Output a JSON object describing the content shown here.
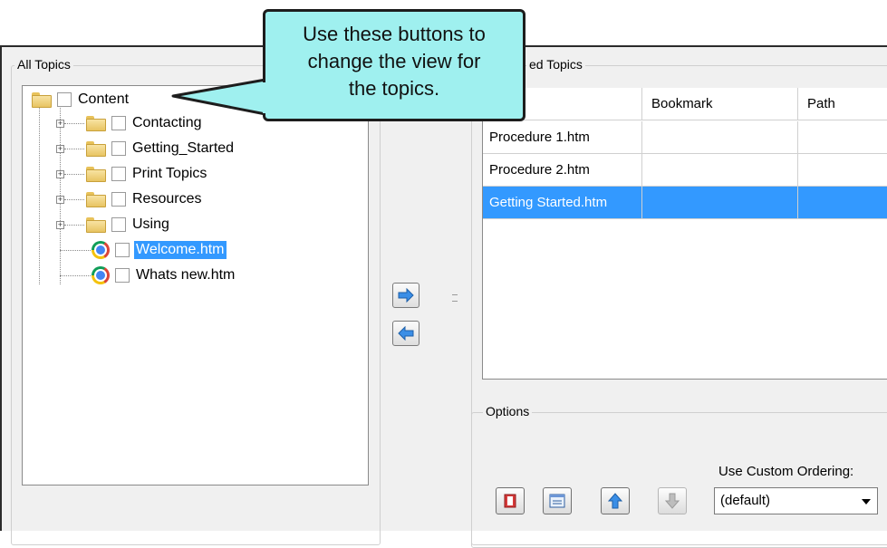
{
  "left_panel": {
    "title": "All Topics",
    "toolbar": [
      {
        "icon": "copy-pages-icon"
      },
      {
        "icon": "folder-view-icon"
      },
      {
        "icon": "list-view-icon"
      },
      {
        "icon": "gray-arrow-icon",
        "disabled": true
      }
    ],
    "tree": {
      "root": {
        "label": "Content"
      },
      "items": [
        {
          "label": "Contacting",
          "type": "folder"
        },
        {
          "label": "Getting_Started",
          "type": "folder"
        },
        {
          "label": "Print Topics",
          "type": "folder"
        },
        {
          "label": "Resources",
          "type": "folder"
        },
        {
          "label": "Using",
          "type": "folder"
        },
        {
          "label": "Welcome.htm",
          "type": "file",
          "selected": true
        },
        {
          "label": "Whats new.htm",
          "type": "file"
        }
      ]
    }
  },
  "right_panel": {
    "title": "Selected Topics",
    "title_visible": "ed Topics",
    "columns": [
      "",
      "Bookmark",
      "Path"
    ],
    "rows": [
      {
        "file": "Procedure 1.htm",
        "bookmark": "",
        "path": ""
      },
      {
        "file": "Procedure 2.htm",
        "bookmark": "",
        "path": ""
      },
      {
        "file": "Getting Started.htm",
        "bookmark": "",
        "path": "",
        "selected": true
      }
    ]
  },
  "options": {
    "title": "Options",
    "ordering_label": "Use Custom Ordering:",
    "ordering_value": "(default)",
    "buttons": [
      {
        "icon": "red-book-icon"
      },
      {
        "icon": "window-list-icon"
      },
      {
        "icon": "move-up-icon"
      },
      {
        "icon": "move-down-icon",
        "disabled": true
      }
    ]
  },
  "callout": {
    "lines": [
      "Use these buttons to",
      "change the view for",
      "the topics."
    ]
  },
  "colors": {
    "selection": "#3399ff",
    "callout_fill": "#9ff0ef",
    "window_bg": "#f0f0f0"
  }
}
